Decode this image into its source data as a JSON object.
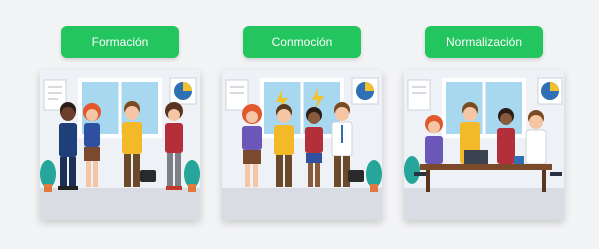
{
  "stages": [
    {
      "label": "Formación",
      "illustration": "team-forming-illustration"
    },
    {
      "label": "Conmoción",
      "illustration": "team-storming-illustration"
    },
    {
      "label": "Normalización",
      "illustration": "team-norming-illustration"
    }
  ],
  "colors": {
    "button": "#22c55e",
    "button_text": "#ffffff",
    "background": "#f3f4f6"
  }
}
